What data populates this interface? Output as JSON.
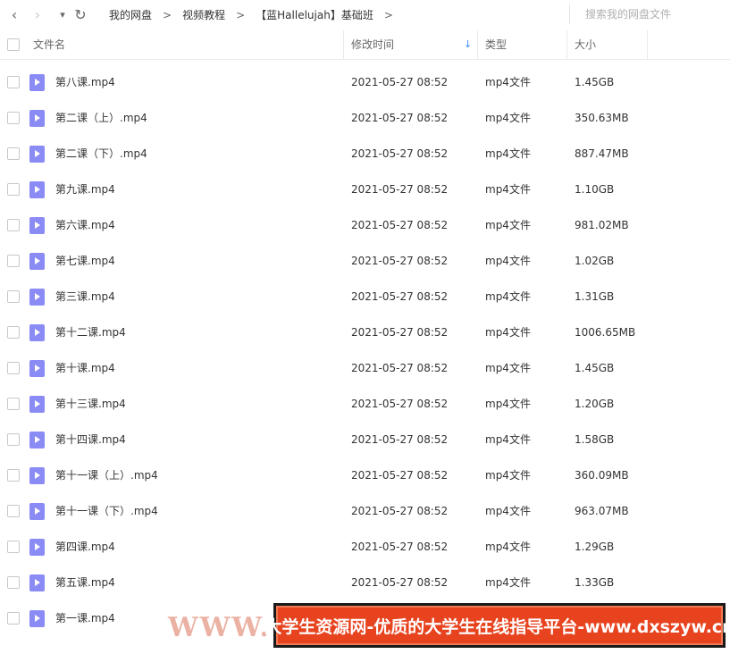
{
  "toolbar": {
    "back_glyph": "‹",
    "forward_glyph": "›",
    "dropdown_glyph": "▾",
    "refresh_glyph": "↻",
    "breadcrumbs": [
      "我的网盘",
      "视频教程",
      "【蓝Hallelujah】基础班"
    ],
    "separator": ">",
    "search_placeholder": "搜索我的网盘文件"
  },
  "columns": {
    "name": "文件名",
    "modified": "修改时间",
    "type": "类型",
    "size": "大小",
    "sort_glyph": "↓"
  },
  "files": [
    {
      "name": "第八课.mp4",
      "modified": "2021-05-27 08:52",
      "type": "mp4文件",
      "size": "1.45GB"
    },
    {
      "name": "第二课（上）.mp4",
      "modified": "2021-05-27 08:52",
      "type": "mp4文件",
      "size": "350.63MB"
    },
    {
      "name": "第二课（下）.mp4",
      "modified": "2021-05-27 08:52",
      "type": "mp4文件",
      "size": "887.47MB"
    },
    {
      "name": "第九课.mp4",
      "modified": "2021-05-27 08:52",
      "type": "mp4文件",
      "size": "1.10GB"
    },
    {
      "name": "第六课.mp4",
      "modified": "2021-05-27 08:52",
      "type": "mp4文件",
      "size": "981.02MB"
    },
    {
      "name": "第七课.mp4",
      "modified": "2021-05-27 08:52",
      "type": "mp4文件",
      "size": "1.02GB"
    },
    {
      "name": "第三课.mp4",
      "modified": "2021-05-27 08:52",
      "type": "mp4文件",
      "size": "1.31GB"
    },
    {
      "name": "第十二课.mp4",
      "modified": "2021-05-27 08:52",
      "type": "mp4文件",
      "size": "1006.65MB"
    },
    {
      "name": "第十课.mp4",
      "modified": "2021-05-27 08:52",
      "type": "mp4文件",
      "size": "1.45GB"
    },
    {
      "name": "第十三课.mp4",
      "modified": "2021-05-27 08:52",
      "type": "mp4文件",
      "size": "1.20GB"
    },
    {
      "name": "第十四课.mp4",
      "modified": "2021-05-27 08:52",
      "type": "mp4文件",
      "size": "1.58GB"
    },
    {
      "name": "第十一课（上）.mp4",
      "modified": "2021-05-27 08:52",
      "type": "mp4文件",
      "size": "360.09MB"
    },
    {
      "name": "第十一课（下）.mp4",
      "modified": "2021-05-27 08:52",
      "type": "mp4文件",
      "size": "963.07MB"
    },
    {
      "name": "第四课.mp4",
      "modified": "2021-05-27 08:52",
      "type": "mp4文件",
      "size": "1.29GB"
    },
    {
      "name": "第五课.mp4",
      "modified": "2021-05-27 08:52",
      "type": "mp4文件",
      "size": "1.33GB"
    },
    {
      "name": "第一课.mp4",
      "modified": "",
      "type": "",
      "size": ""
    }
  ],
  "file_icon": "video-file-icon",
  "watermark": "WWW. C",
  "banner": "大学生资源网-优质的大学生在线指导平台-www.dxszyw.cn",
  "colors": {
    "accent": "#3f8cff",
    "file_icon": "#8b8bf5",
    "banner_bg": "#e8431f"
  }
}
